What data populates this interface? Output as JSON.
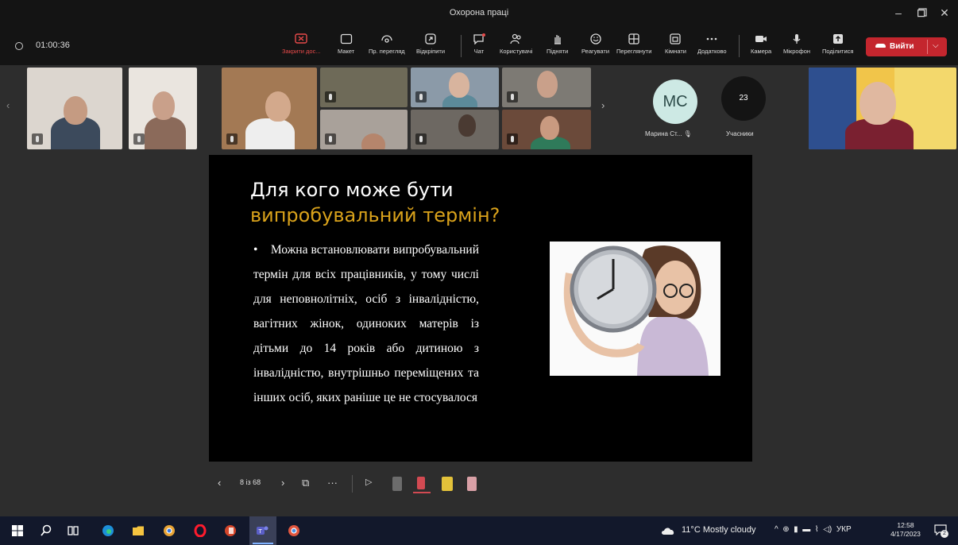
{
  "window": {
    "title": "Охорона праці"
  },
  "meeting": {
    "timer": "01:00:36",
    "toolbar": [
      {
        "label": "Закрити дос...",
        "icon": "stop-share-icon",
        "color": "#e84a4a"
      },
      {
        "label": "Макет",
        "icon": "layout-icon"
      },
      {
        "label": "Пр. перегляд",
        "icon": "preview-icon"
      },
      {
        "label": "Відкріпити",
        "icon": "unpin-icon"
      },
      {
        "label": "Чат",
        "icon": "chat-icon"
      },
      {
        "label": "Користувачі",
        "icon": "people-icon"
      },
      {
        "label": "Підняти",
        "icon": "raise-hand-icon"
      },
      {
        "label": "Реагувати",
        "icon": "react-icon"
      },
      {
        "label": "Переглянути",
        "icon": "view-icon"
      },
      {
        "label": "Кімнати",
        "icon": "rooms-icon"
      },
      {
        "label": "Додатково",
        "icon": "more-icon"
      },
      {
        "label": "Камера",
        "icon": "camera-icon"
      },
      {
        "label": "Мікрофон",
        "icon": "mic-icon"
      },
      {
        "label": "Поділитися",
        "icon": "share-icon"
      }
    ],
    "leave_label": "Вийти",
    "leave_color": "#c4262e"
  },
  "participants": {
    "avatar_initials": "MC",
    "avatar_name": "Марина Ст...",
    "count": "23",
    "count_label": "Учасники"
  },
  "slide": {
    "title_line1": "Для кого може бути",
    "title_line2": "випробувальний термін?",
    "accent_color": "#d9a21b",
    "bullet": "•",
    "body": "Можна встановлювати випробувальний термін для всіх працівників, у тому числі для неповнолітніх, осіб з інвалідністю, вагітних жінок, одиноких матерів із дітьми до 14 років або дитиною з інвалідністю, внутрішньо переміщених та інших осіб, яких раніше це не стосувалося"
  },
  "presenter_controls": {
    "page": "8 із 68"
  },
  "taskbar": {
    "weather": "11°C  Mostly cloudy",
    "lang": "УКР",
    "time": "12:58",
    "date": "4/17/2023",
    "notifications": "2"
  }
}
